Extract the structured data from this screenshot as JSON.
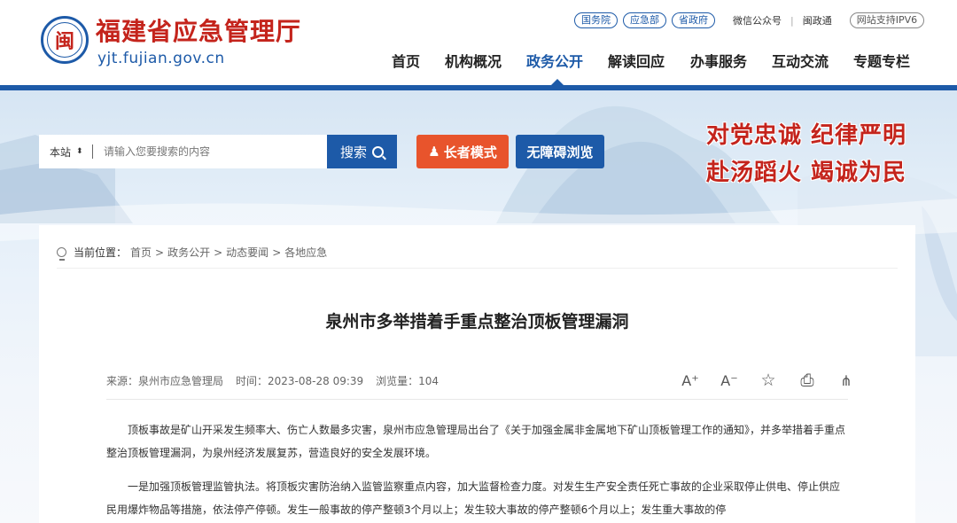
{
  "header": {
    "site_title": "福建省应急管理厅",
    "domain": "yjt.fujian.gov.cn",
    "emblem_char": "闽",
    "top_links": {
      "gov": "国务院",
      "mem": "应急部",
      "prov": "省政府",
      "wechat": "微信公众号",
      "sep": "|",
      "mzt": "闽政通",
      "ipv6": "网站支持IPV6"
    },
    "nav": [
      "首页",
      "机构概况",
      "政务公开",
      "解读回应",
      "办事服务",
      "互动交流",
      "专题专栏"
    ],
    "nav_active_index": 2
  },
  "banner": {
    "search_scope": "本站",
    "search_placeholder": "请输入您要搜索的内容",
    "search_button": "搜索",
    "elder_mode": "长者模式",
    "accessible": "无障碍浏览",
    "slogan_line1": "对党忠诚  纪律严明",
    "slogan_line2": "赴汤蹈火  竭诚为民"
  },
  "breadcrumb": {
    "lead": "当前位置：",
    "items": [
      "首页",
      "政务公开",
      "动态要闻",
      "各地应急"
    ],
    "separator": ">"
  },
  "article": {
    "title": "泉州市多举措着手重点整治顶板管理漏洞",
    "source": "来源：泉州市应急管理局",
    "time": "时间：2023-08-28 09:39",
    "views": "浏览量：104",
    "tools": {
      "font_up": "A⁺",
      "font_down": "A⁻",
      "favorite": "☆",
      "print": "⎙",
      "share": "⋔"
    },
    "paragraphs": [
      "顶板事故是矿山开采发生频率大、伤亡人数最多灾害，泉州市应急管理局出台了《关于加强金属非金属地下矿山顶板管理工作的通知》，并多举措着手重点整治顶板管理漏洞，为泉州经济发展复苏，营造良好的安全发展环境。",
      "一是加强顶板管理监管执法。将顶板灾害防治纳入监管监察重点内容，加大监督检查力度。对发生生产安全责任死亡事故的企业采取停止供电、停止供应民用爆炸物品等措施，依法停产停顿。发生一般事故的停产整顿3个月以上；发生较大事故的停产整顿6个月以上；发生重大事故的停"
    ]
  },
  "colors": {
    "brand_blue": "#1d5aa8",
    "brand_red": "#c4241c",
    "elder_orange": "#e8542c"
  }
}
